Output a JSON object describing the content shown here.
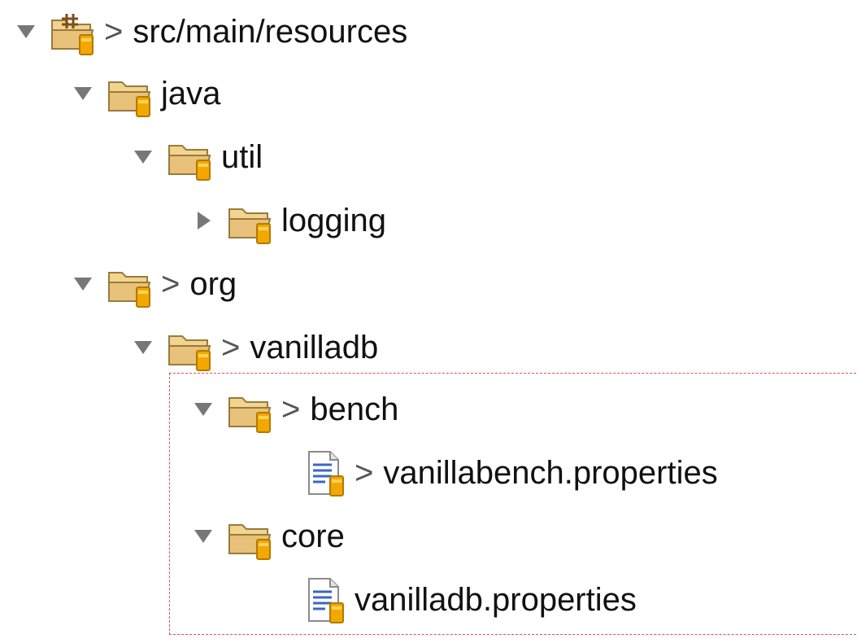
{
  "tree": [
    {
      "label": "src/main/resources",
      "dirty": ">",
      "icon": "source-folder-icon",
      "expanded": true
    },
    {
      "label": "java",
      "dirty": "",
      "icon": "package-folder-icon",
      "expanded": true
    },
    {
      "label": "util",
      "dirty": "",
      "icon": "package-folder-icon",
      "expanded": true
    },
    {
      "label": "logging",
      "dirty": "",
      "icon": "package-folder-icon",
      "expanded": false
    },
    {
      "label": "org",
      "dirty": ">",
      "icon": "package-folder-icon",
      "expanded": true
    },
    {
      "label": "vanilladb",
      "dirty": ">",
      "icon": "package-folder-icon",
      "expanded": true
    },
    {
      "label": "bench",
      "dirty": ">",
      "icon": "package-folder-icon",
      "expanded": true
    },
    {
      "label": "vanillabench.properties",
      "dirty": ">",
      "icon": "properties-file-icon"
    },
    {
      "label": "core",
      "dirty": "",
      "icon": "package-folder-icon",
      "expanded": true
    },
    {
      "label": "vanilladb.properties",
      "dirty": "",
      "icon": "properties-file-icon"
    }
  ],
  "colors": {
    "folder": "#e8c27a",
    "folder_outline": "#9a7a3c",
    "repo_badge": "#f2a800",
    "highlight_border": "#e05050",
    "twisty": "#777777"
  }
}
